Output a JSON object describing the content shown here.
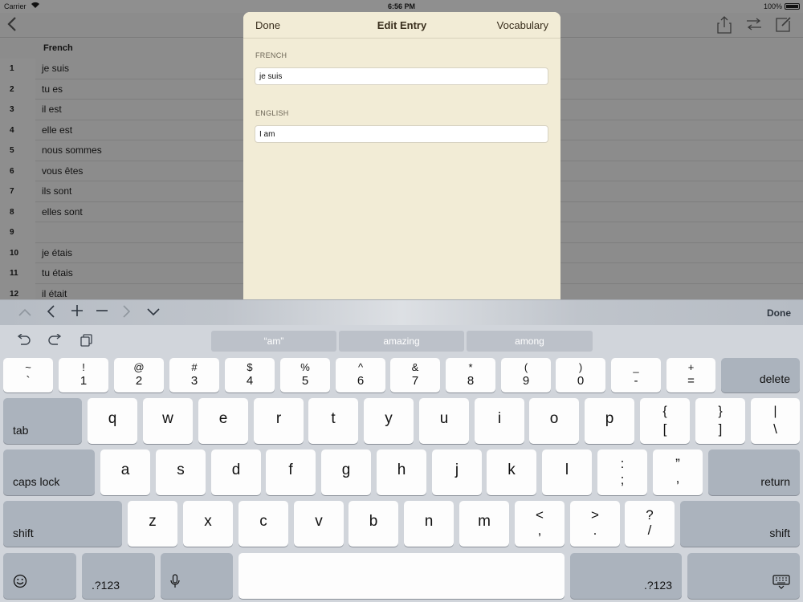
{
  "status_bar": {
    "carrier": "Carrier",
    "time": "6:56 PM",
    "battery": "100%"
  },
  "nav": {
    "back_icon": "chevron-left-icon",
    "icons": [
      "share-icon",
      "swap-icon",
      "compose-icon"
    ]
  },
  "table": {
    "column_header": "French",
    "rows": [
      {
        "num": "1",
        "text": "je suis"
      },
      {
        "num": "2",
        "text": "tu es"
      },
      {
        "num": "3",
        "text": "il est"
      },
      {
        "num": "4",
        "text": "elle est"
      },
      {
        "num": "5",
        "text": "nous sommes"
      },
      {
        "num": "6",
        "text": "vous êtes"
      },
      {
        "num": "7",
        "text": "ils sont"
      },
      {
        "num": "8",
        "text": "elles sont"
      },
      {
        "num": "9",
        "text": ""
      },
      {
        "num": "10",
        "text": "je étais"
      },
      {
        "num": "11",
        "text": "tu étais"
      },
      {
        "num": "12",
        "text": "il était"
      }
    ]
  },
  "modal": {
    "done": "Done",
    "title": "Edit Entry",
    "vocabulary": "Vocabulary",
    "french_label": "FRENCH",
    "french_value": "je suis",
    "english_label": "ENGLISH",
    "english_value": "I am"
  },
  "accessory": {
    "done": "Done"
  },
  "keyboard": {
    "suggestions": [
      "“am”",
      "amazing",
      "among"
    ],
    "row1": [
      {
        "top": "~",
        "bot": "`"
      },
      {
        "top": "!",
        "bot": "1"
      },
      {
        "top": "@",
        "bot": "2"
      },
      {
        "top": "#",
        "bot": "3"
      },
      {
        "top": "$",
        "bot": "4"
      },
      {
        "top": "%",
        "bot": "5"
      },
      {
        "top": "^",
        "bot": "6"
      },
      {
        "top": "&",
        "bot": "7"
      },
      {
        "top": "*",
        "bot": "8"
      },
      {
        "top": "(",
        "bot": "9"
      },
      {
        "top": ")",
        "bot": "0"
      },
      {
        "top": "_",
        "bot": "-"
      },
      {
        "top": "+",
        "bot": "="
      }
    ],
    "delete": "delete",
    "tab": "tab",
    "row2": [
      "q",
      "w",
      "e",
      "r",
      "t",
      "y",
      "u",
      "i",
      "o",
      "p"
    ],
    "row2_sym": [
      {
        "top": "{",
        "bot": "["
      },
      {
        "top": "}",
        "bot": "]"
      },
      {
        "top": "|",
        "bot": "\\"
      }
    ],
    "caps_lock": "caps lock",
    "row3": [
      "a",
      "s",
      "d",
      "f",
      "g",
      "h",
      "j",
      "k",
      "l"
    ],
    "row3_sym": [
      {
        "top": ":",
        "bot": ";"
      },
      {
        "top": "”",
        "bot": ","
      }
    ],
    "return": "return",
    "shift": "shift",
    "row4": [
      "z",
      "x",
      "c",
      "v",
      "b",
      "n",
      "m"
    ],
    "row4_sym": [
      {
        "top": "<",
        "bot": ","
      },
      {
        "top": ">",
        "bot": "."
      },
      {
        "top": "?",
        "bot": "/"
      }
    ],
    "numbers": ".?123"
  }
}
